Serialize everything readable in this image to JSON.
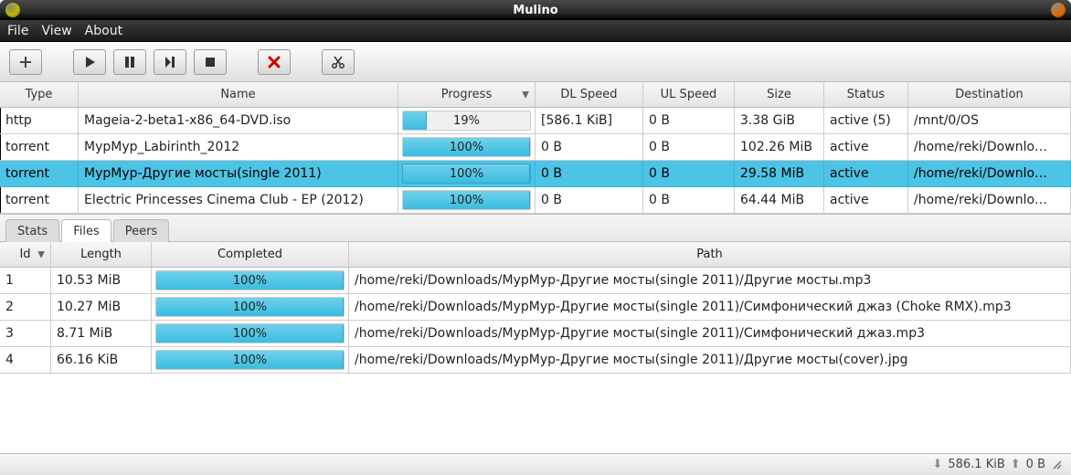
{
  "window": {
    "title": "Mulino"
  },
  "menu": {
    "file": "File",
    "view": "View",
    "about": "About"
  },
  "toolbar": {
    "add": "add",
    "start": "start",
    "pause": "pause",
    "next": "next",
    "stop": "stop",
    "remove": "remove",
    "cut": "cut"
  },
  "columns": {
    "type": "Type",
    "name": "Name",
    "progress": "Progress",
    "dl": "DL Speed",
    "ul": "UL Speed",
    "size": "Size",
    "status": "Status",
    "dest": "Destination"
  },
  "downloads": [
    {
      "type": "http",
      "name": "Mageia-2-beta1-x86_64-DVD.iso",
      "progress_text": "19%",
      "progress_pct": 19,
      "dl": "[586.1 KiB]",
      "ul": "0 B",
      "size": "3.38 GiB",
      "status": "active (5)",
      "dest": "/mnt/0/OS",
      "selected": false
    },
    {
      "type": "torrent",
      "name": "MypMyp_Labirinth_2012",
      "progress_text": "100%",
      "progress_pct": 100,
      "dl": "0 B",
      "ul": "0 B",
      "size": "102.26 MiB",
      "status": "active",
      "dest": "/home/reki/Downlo…",
      "selected": false
    },
    {
      "type": "torrent",
      "name": "МурМур-Другие мосты(single 2011)",
      "progress_text": "100%",
      "progress_pct": 100,
      "dl": "0 B",
      "ul": "0 B",
      "size": "29.58 MiB",
      "status": "active",
      "dest": "/home/reki/Downlo…",
      "selected": true
    },
    {
      "type": "torrent",
      "name": "Electric Princesses Cinema Club - EP (2012)",
      "progress_text": "100%",
      "progress_pct": 100,
      "dl": "0 B",
      "ul": "0 B",
      "size": "64.44 MiB",
      "status": "active",
      "dest": "/home/reki/Downlo…",
      "selected": false
    }
  ],
  "tabs": {
    "stats": "Stats",
    "files": "Files",
    "peers": "Peers",
    "active": "files"
  },
  "file_columns": {
    "id": "Id",
    "length": "Length",
    "completed": "Completed",
    "path": "Path"
  },
  "files": [
    {
      "id": "1",
      "length": "10.53 MiB",
      "completed_text": "100%",
      "completed_pct": 100,
      "path": "/home/reki/Downloads/МурМур-Другие мосты(single 2011)/Другие мосты.mp3"
    },
    {
      "id": "2",
      "length": "10.27 MiB",
      "completed_text": "100%",
      "completed_pct": 100,
      "path": "/home/reki/Downloads/МурМур-Другие мосты(single 2011)/Симфонический джаз (Choke RMX).mp3"
    },
    {
      "id": "3",
      "length": "8.71 MiB",
      "completed_text": "100%",
      "completed_pct": 100,
      "path": "/home/reki/Downloads/МурМур-Другие мосты(single 2011)/Симфонический джаз.mp3"
    },
    {
      "id": "4",
      "length": "66.16 KiB",
      "completed_text": "100%",
      "completed_pct": 100,
      "path": "/home/reki/Downloads/МурМур-Другие мосты(single 2011)/Другие мосты(cover).jpg"
    }
  ],
  "status": {
    "down": "586.1 KiB",
    "up": "0 B"
  }
}
